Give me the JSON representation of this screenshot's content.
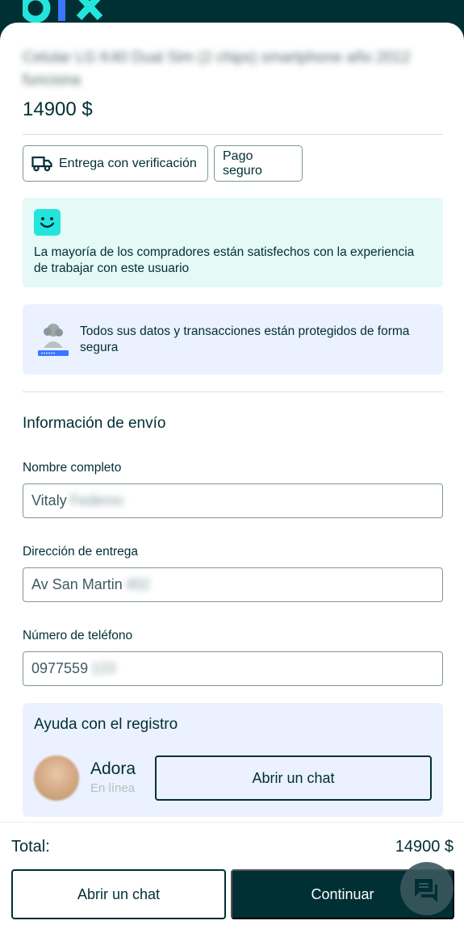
{
  "brand": {
    "logo_text": "olx"
  },
  "listing": {
    "title": "Celular LG K40 Dual Sim (2 chips) smartphone año 2012 funciona",
    "price": "14900 $"
  },
  "chips": [
    {
      "label": "Entrega con verificación",
      "icon": "truck-icon"
    },
    {
      "label": "Pago seguro"
    }
  ],
  "cards": {
    "satisfied": "La mayoría de los compradores están satisfechos con la experiencia de trabajar con este usuario",
    "security": "Todos sus datos y transacciones están protegidos de forma segura"
  },
  "shipping": {
    "title": "Información de envío",
    "fields": [
      {
        "label": "Nombre completo",
        "value": "Vitaly",
        "hidden_part": "Federov"
      },
      {
        "label": "Dirección de entrega",
        "value": "Av San Martin",
        "hidden_part": "402"
      },
      {
        "label": "Número de teléfono",
        "value": "0977559",
        "hidden_part": "123"
      }
    ]
  },
  "help": {
    "title": "Ayuda con el registro",
    "agent_name": "Adora",
    "agent_status": "En línea",
    "chat_button": "Abrir un chat"
  },
  "footer": {
    "total_label": "Total:",
    "total_value": "14900 $",
    "chat_button": "Abrir un chat",
    "continue_button": "Continuar"
  },
  "colors": {
    "brand_dark": "#002f34",
    "accent_teal": "#23e5db",
    "card_green": "#e5f9f6",
    "card_blue": "#ebf1ff"
  }
}
